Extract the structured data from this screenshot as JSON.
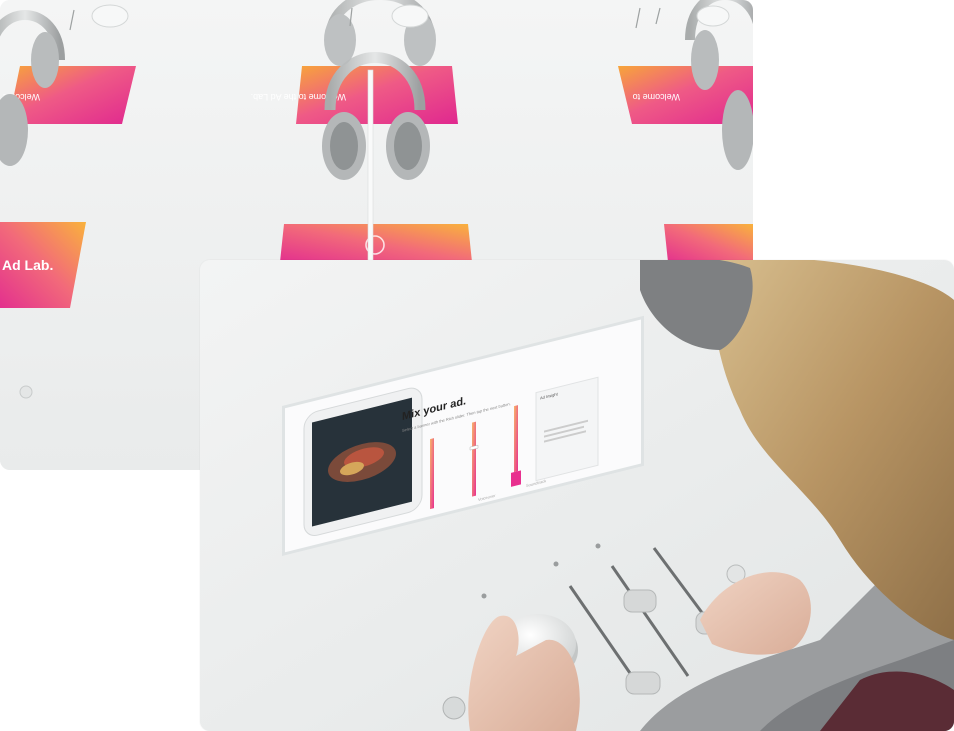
{
  "back_photo": {
    "screens": [
      {
        "text": "Welcome to"
      },
      {
        "text": "Welcome to the Ad Lab."
      },
      {
        "text": "Welcome to"
      },
      {
        "text": "Ad Lab."
      },
      {
        "text": ""
      },
      {
        "text": ""
      }
    ]
  },
  "front_photo": {
    "tablet": {
      "heading": "Mix your ad.",
      "instruction": "Select a banner with the Rich slider. Then tap the next button.",
      "panel_title": "Ad Insight",
      "label_1": "Voiceover",
      "label_2": "Soundtrack"
    }
  },
  "colors": {
    "brand_pink": "#e8308f",
    "brand_orange": "#f6a23a",
    "table_white": "#f1f2f2"
  }
}
